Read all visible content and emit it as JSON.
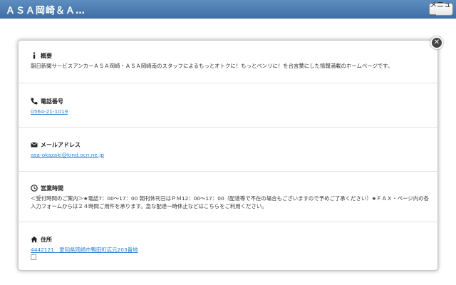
{
  "header": {
    "title": "ＡＳＡ岡崎＆Ａ…",
    "menu_label": "メニュー"
  },
  "popup": {
    "close_glyph": "✕",
    "sections": {
      "overview": {
        "heading": "概要",
        "text": "朝日新聞サービスアンカーＡＳＡ岡崎・ＡＳＡ岡崎南のスタッフによるもっとオトクに！もっとベンリに！を合言葉にした情報満載のホームページです。"
      },
      "phone": {
        "heading": "電話番号",
        "value": "0564-21-1019"
      },
      "email": {
        "heading": "メールアドレス",
        "value": "asa-okazaki@kind.ocn.ne.jp"
      },
      "hours": {
        "heading": "営業時間",
        "text": "＜受付時間のご案内＞★電話7：00〜17：00 朝刊休刊日はＰＭ12：00〜17：00（配達等で不在の場合もございますので予めご了承ください）★ＦＡＸ・ページ内の各入力フォームからは２４時間ご用件を承ります。急な配達一時休止などはこちらをご利用ください。"
      },
      "address": {
        "heading": "住所",
        "value": "4442121　愛知県岡崎市鴨田町広元203番地"
      }
    }
  },
  "colors": {
    "header_top": "#5e8dc0",
    "header_bottom": "#3f6fa5",
    "link": "#2a7fd4"
  }
}
